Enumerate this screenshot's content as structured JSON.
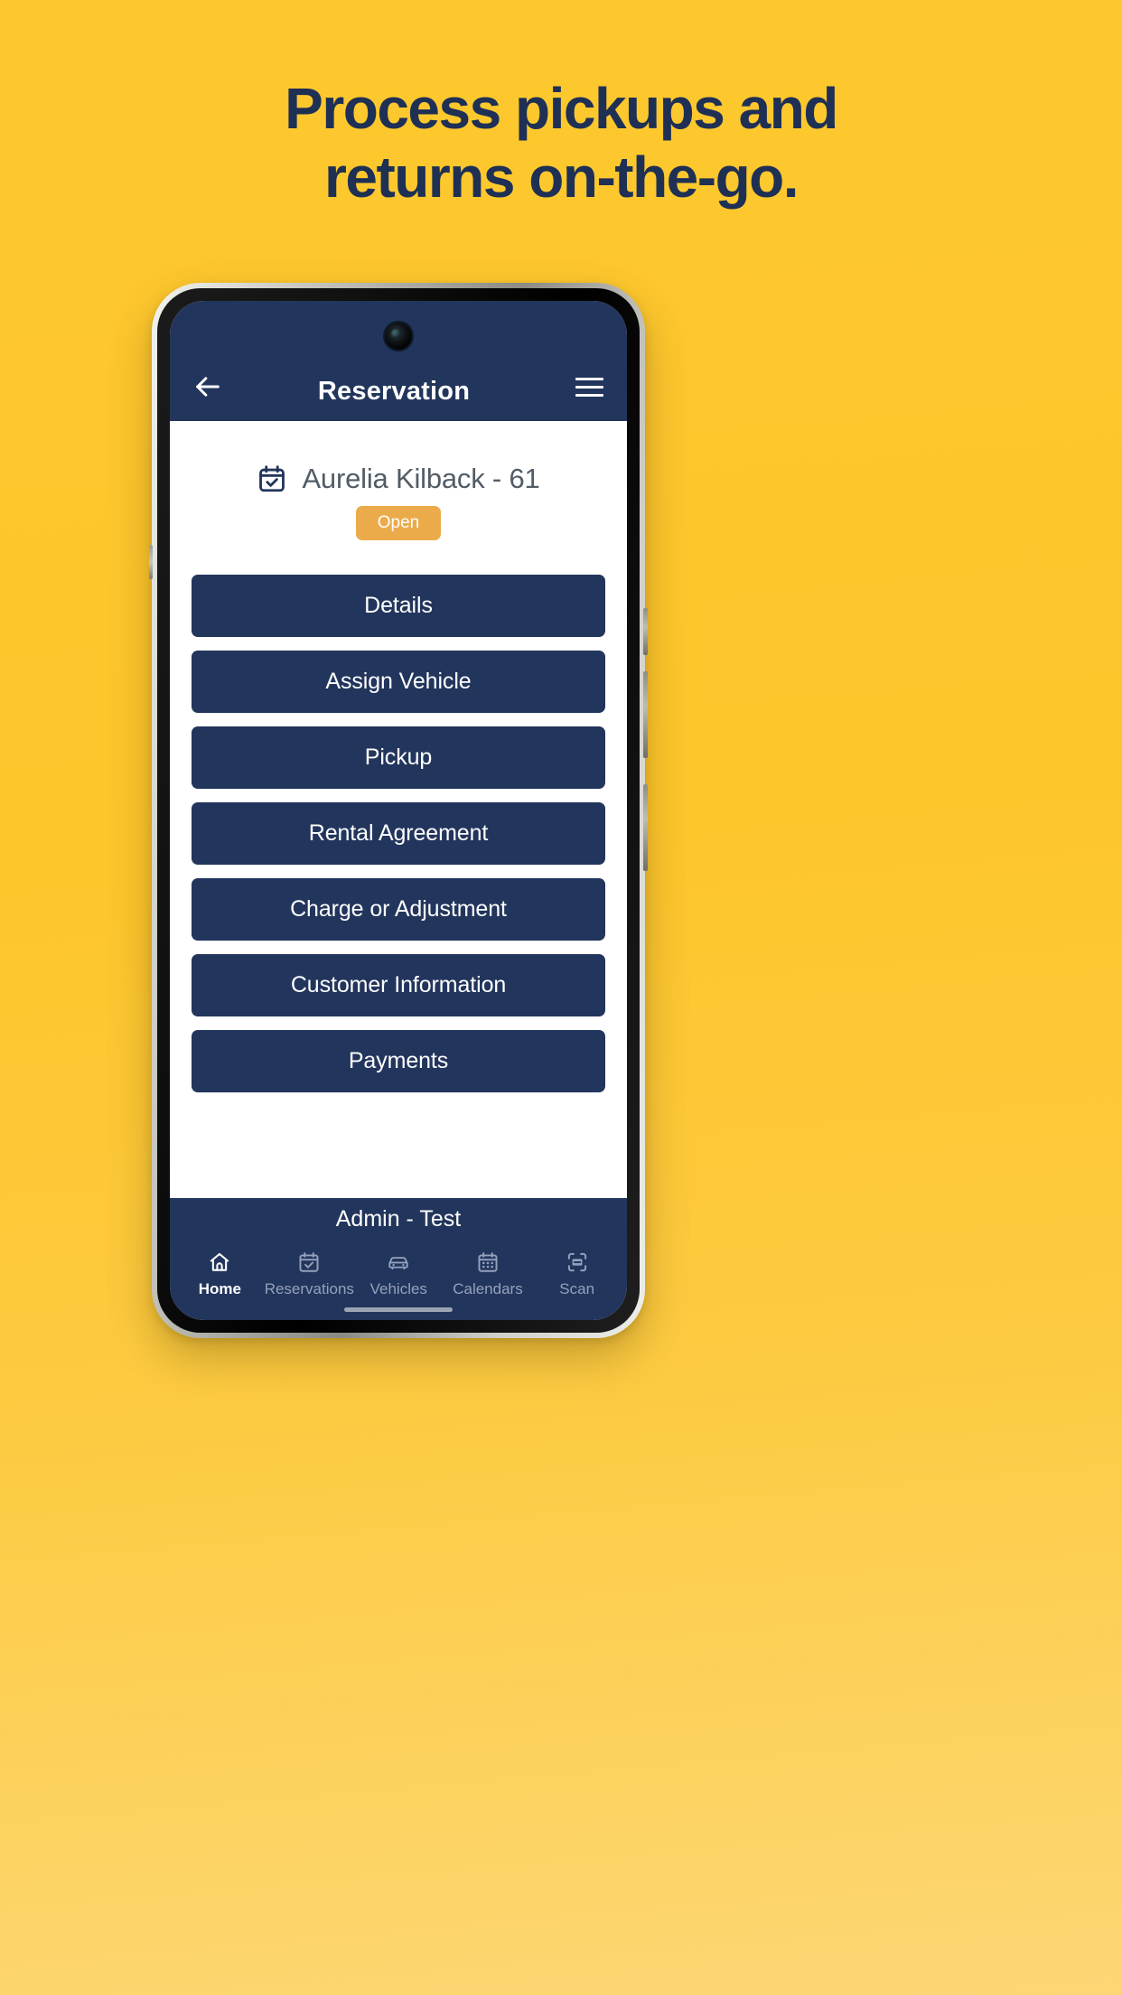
{
  "marketing": {
    "headline_line1": "Process pickups and",
    "headline_line2": "returns on-the-go.",
    "background_color": "#FDC62B",
    "headline_color": "#1F3055"
  },
  "appbar": {
    "title": "Reservation",
    "back_icon": "arrow-left-icon",
    "menu_icon": "hamburger-menu-icon",
    "background_color": "#22355C"
  },
  "reservation": {
    "icon": "calendar-check-icon",
    "name": "Aurelia Kilback - 61",
    "status_label": "Open",
    "status_color": "#EBAB4B"
  },
  "menu": {
    "items": [
      {
        "label": "Details"
      },
      {
        "label": "Assign Vehicle"
      },
      {
        "label": "Pickup"
      },
      {
        "label": "Rental Agreement"
      },
      {
        "label": "Charge or Adjustment"
      },
      {
        "label": "Customer Information"
      },
      {
        "label": "Payments"
      }
    ]
  },
  "footer": {
    "user_label": "Admin - Test"
  },
  "bottom_nav": {
    "items": [
      {
        "label": "Home",
        "icon": "home-icon",
        "active": true
      },
      {
        "label": "Reservations",
        "icon": "calendar-check-icon",
        "active": false
      },
      {
        "label": "Vehicles",
        "icon": "car-icon",
        "active": false
      },
      {
        "label": "Calendars",
        "icon": "calendar-icon",
        "active": false
      },
      {
        "label": "Scan",
        "icon": "scan-icon",
        "active": false
      }
    ]
  }
}
